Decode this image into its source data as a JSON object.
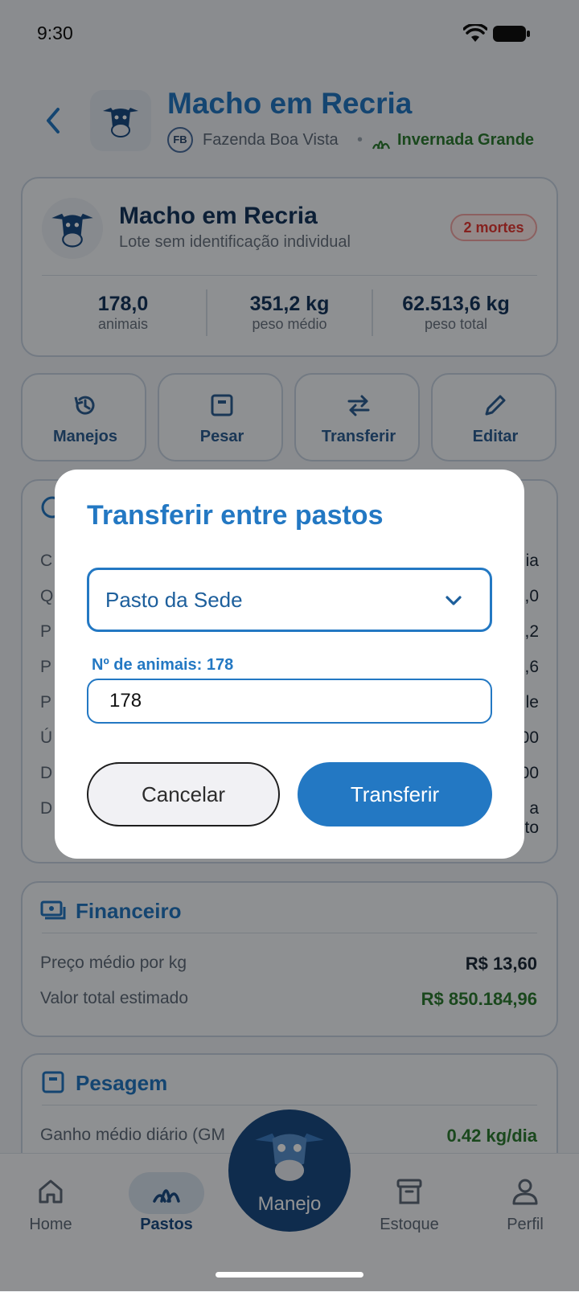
{
  "status_bar": {
    "time": "9:30"
  },
  "header": {
    "title": "Macho em Recria",
    "farm_badge": "FB",
    "farm_name": "Fazenda Boa Vista",
    "separator": "•",
    "pasture_name": "Invernada Grande"
  },
  "lote": {
    "title": "Macho em Recria",
    "subtitle": "Lote sem identificação individual",
    "badge": "2 mortes",
    "stats": [
      {
        "value": "178,0",
        "label": "animais"
      },
      {
        "value": "351,2 kg",
        "label": "peso médio"
      },
      {
        "value": "62.513,6 kg",
        "label": "peso total"
      }
    ]
  },
  "actions": [
    {
      "label": "Manejos",
      "icon": "history-icon"
    },
    {
      "label": "Pesar",
      "icon": "scale-icon"
    },
    {
      "label": "Transferir",
      "icon": "swap-icon"
    },
    {
      "label": "Editar",
      "icon": "pencil-icon"
    }
  ],
  "info_partial": {
    "left": [
      "C",
      "Q",
      "P",
      "P",
      "P",
      "Ú",
      "D",
      "D"
    ],
    "right": [
      "ia",
      ",0",
      ",2",
      ",6",
      "le",
      "00",
      "00",
      "a",
      "to"
    ]
  },
  "financeiro": {
    "title": "Financeiro",
    "rows": [
      {
        "label": "Preço médio por kg",
        "value": "R$ 13,60"
      },
      {
        "label": "Valor total estimado",
        "value": "R$ 850.184,96"
      }
    ]
  },
  "pesagem": {
    "title": "Pesagem",
    "rows": [
      {
        "label": "Ganho médio diário (GM",
        "value": "0.42 kg/dia"
      }
    ]
  },
  "bottom_nav": {
    "items": [
      "Home",
      "Pastos",
      "Estoque",
      "Perfil"
    ],
    "fab_label": "Manejo"
  },
  "modal": {
    "title": "Transferir entre pastos",
    "select_value": "Pasto da Sede",
    "count_label": "Nº de animais: 178",
    "count_value": "178",
    "cancel_label": "Cancelar",
    "confirm_label": "Transferir"
  },
  "colors": {
    "accent": "#2378c3",
    "dark_navy": "#16365e",
    "green": "#2e7d32",
    "danger": "#e53935"
  }
}
